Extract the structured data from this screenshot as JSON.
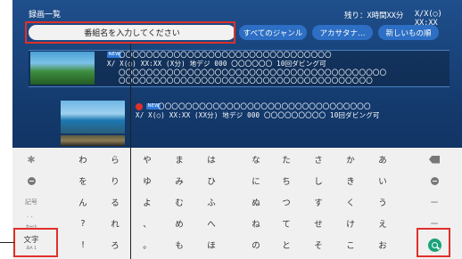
{
  "header": {
    "title": "録画一覧",
    "remaining": "残り：X時間XX分",
    "clock": "X/X(◯) XX:XX"
  },
  "toolbar": {
    "search_placeholder": "番組名を入力してください",
    "genre_label": "すべてのジャンル",
    "kana_label": "アカサタナ…",
    "sort_label": "新しいもの順"
  },
  "recordings": [
    {
      "new_badge": "NEW",
      "title": "〇〇〇〇〇〇〇〇〇〇〇〇〇〇〇〇〇〇〇〇〇〇〇〇〇〇〇〇〇〇〇",
      "meta": "X/ X(◯) XX:XX (X分) 地デジ 000 〇〇〇〇〇〇 10回ダビング可",
      "line3": "〇〇〇〇〇〇〇〇〇〇〇〇〇〇〇〇〇〇〇〇〇〇〇〇〇〇〇〇〇〇〇〇〇〇〇〇〇〇〇",
      "line4": "〇〇〇〇〇〇〇〇〇〇〇〇〇〇〇〇〇〇〇〇〇〇〇〇〇〇〇〇〇〇〇〇〇〇〇〇〇"
    },
    {
      "new_badge": "NEW",
      "title": "〇〇〇〇〇〇〇〇〇〇〇〇〇〇〇〇〇〇〇〇〇〇〇〇〇〇〇〇〇〇〇",
      "meta": "X/ X(◯) XX:XX (XX分) 地デジ 000 〇〇〇〇〇〇〇〇〇 10回ダビング可"
    }
  ],
  "keyboard": {
    "rows": [
      [
        "わ",
        "ら",
        "や",
        "ま",
        "は",
        "な",
        "た",
        "さ",
        "か",
        "あ"
      ],
      [
        "を",
        "り",
        "ゆ",
        "み",
        "ひ",
        "に",
        "ち",
        "し",
        "き",
        "い"
      ],
      [
        "ん",
        "る",
        "よ",
        "む",
        "ふ",
        "ぬ",
        "つ",
        "す",
        "く",
        "う"
      ],
      [
        "?",
        "れ",
        "、",
        "め",
        "へ",
        "ね",
        "て",
        "せ",
        "け",
        "え"
      ],
      [
        "!",
        "ろ",
        "。",
        "も",
        "ほ",
        "の",
        "と",
        "そ",
        "こ",
        "お"
      ]
    ],
    "left_keys": {
      "row3": "記号",
      "row4_top": "゛゜",
      "row4_bottom": "大⇔小",
      "row5_top": "文字",
      "row5_bottom": "あA 1"
    },
    "right_keys": {
      "row3": "ー",
      "row4": "ー"
    }
  },
  "colors": {
    "screen_bg": "#1a4780",
    "highlight_frame": "#e0302a",
    "pill_bg": "#2d6fc4",
    "search_button": "#1aa37a"
  },
  "icons": [
    "settings-gear-icon",
    "cursor-left-icon",
    "cursor-right-icon",
    "backspace-icon",
    "search-icon",
    "record-dot-icon"
  ]
}
